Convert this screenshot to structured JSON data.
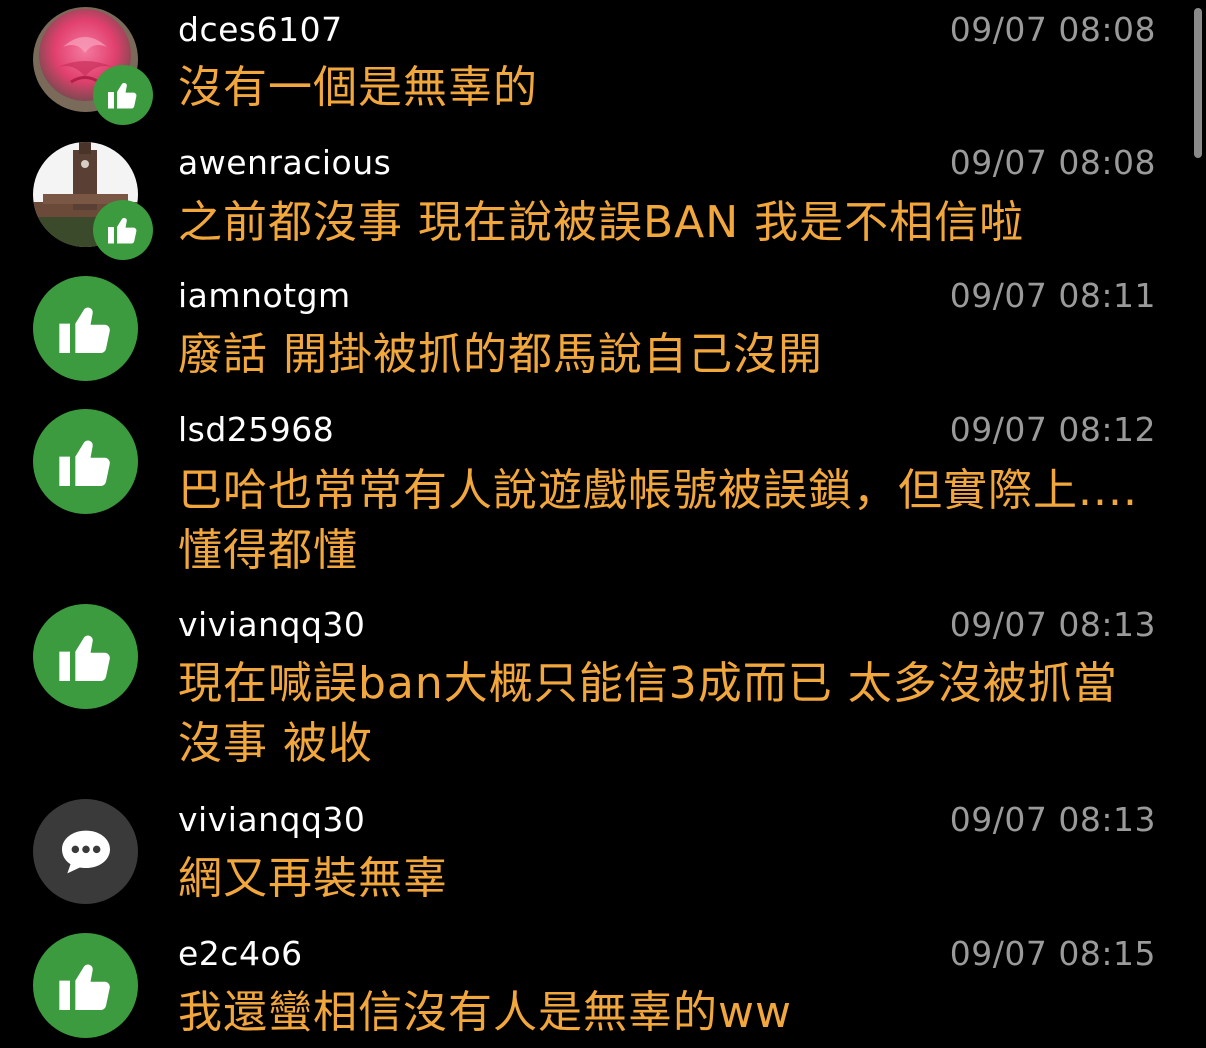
{
  "comments": [
    {
      "username": "dces6107",
      "time": "09/07 08:08",
      "text": "沒有一個是無辜的",
      "avatar": "pink-flower-photo",
      "badge": "thumbs-up-icon"
    },
    {
      "username": "awenracious",
      "time": "09/07 08:08",
      "text": "之前都沒事 現在說被誤BAN  我是不相信啦",
      "avatar": "clock-tower-photo",
      "badge": "thumbs-up-icon"
    },
    {
      "username": "iamnotgm",
      "time": "09/07 08:11",
      "text": "廢話 開掛被抓的都馬說自己沒開",
      "avatar": "thumbs-up-icon"
    },
    {
      "username": "lsd25968",
      "time": "09/07 08:12",
      "text": "巴哈也常常有人說遊戲帳號被誤鎖，但實際上....懂得都懂",
      "avatar": "thumbs-up-icon"
    },
    {
      "username": "vivianqq30",
      "time": "09/07 08:13",
      "text": "現在喊誤ban大概只能信3成而已 太多沒被抓當沒事 被收",
      "avatar": "thumbs-up-icon"
    },
    {
      "username": "vivianqq30",
      "time": "09/07 08:13",
      "text": "網又再裝無辜",
      "avatar": "speech-bubble-icon"
    },
    {
      "username": "e2c4o6",
      "time": "09/07 08:15",
      "text": "我還蠻相信沒有人是無辜的ww",
      "avatar": "thumbs-up-icon"
    }
  ],
  "colors": {
    "background": "#000000",
    "username": "#ffffff",
    "timestamp": "#9a9a9a",
    "comment_text": "#f2a73d",
    "like_green": "#3c9a3f",
    "neutral_gray": "#3a3a3a"
  }
}
